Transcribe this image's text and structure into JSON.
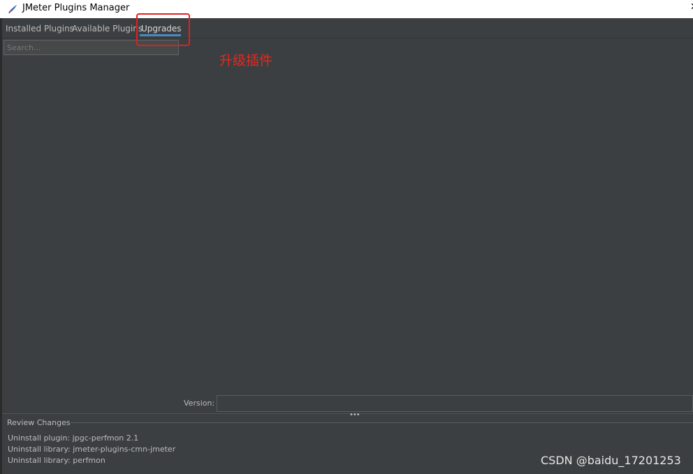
{
  "window": {
    "title": "JMeter Plugins Manager",
    "close_glyph": "✕"
  },
  "tabs": [
    {
      "label": "Installed Plugins"
    },
    {
      "label": "Available Plugins"
    },
    {
      "label": "Upgrades",
      "selected": true
    }
  ],
  "search": {
    "placeholder": "Search...",
    "value": ""
  },
  "annotation": {
    "text": "升级插件",
    "color": "#e8261e"
  },
  "version": {
    "label": "Version:",
    "value": ""
  },
  "review": {
    "title": "Review Changes",
    "items": [
      "Uninstall plugin: jpgc-perfmon 2.1",
      "Uninstall library: jmeter-plugins-cmn-jmeter",
      "Uninstall library: perfmon"
    ]
  },
  "watermark": "CSDN @baidu_17201253",
  "colors": {
    "background": "#3c3f41",
    "accent": "#4a88c7",
    "highlight": "#e02020"
  }
}
